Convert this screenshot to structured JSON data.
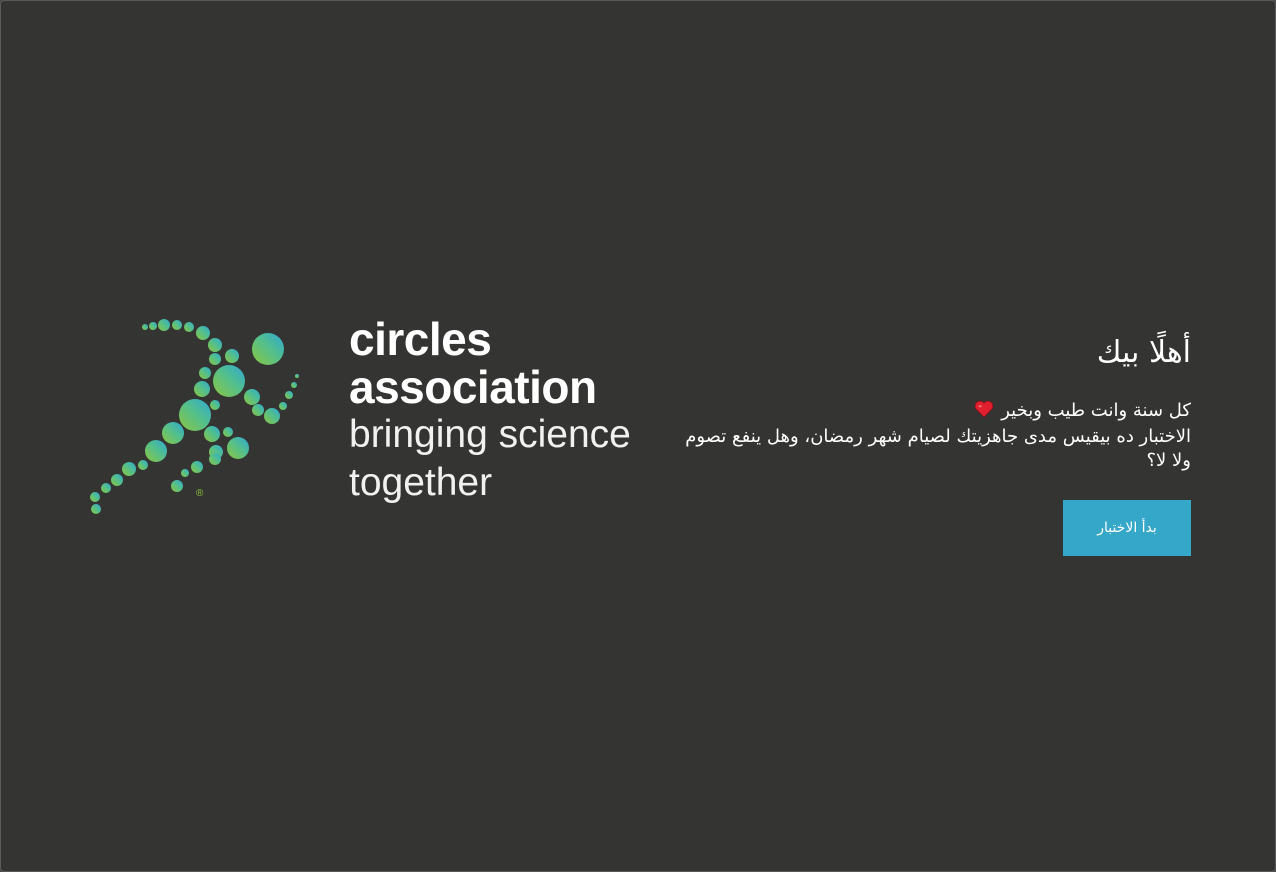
{
  "logo": {
    "line1": "circles",
    "line2": "association",
    "tagline1": "bringing science",
    "tagline2": "together",
    "registered_mark": "®"
  },
  "intro": {
    "greeting": "أهلًا بيك",
    "line1": "كل سنة وانت طيب وبخير",
    "line2": "الاختبار ده بيقيس مدى جاهزيتك لصيام شهر رمضان، وهل ينفع تصوم ولا لا؟"
  },
  "start_button": {
    "label": "بدأ الاختبار"
  },
  "icons": {
    "heart": "heart-icon"
  },
  "colors": {
    "background": "#343432",
    "button": "#35a8c9",
    "heart": "#e0202e",
    "logo_gradient_start": "#8cc63f",
    "logo_gradient_end": "#2fa8d5"
  }
}
